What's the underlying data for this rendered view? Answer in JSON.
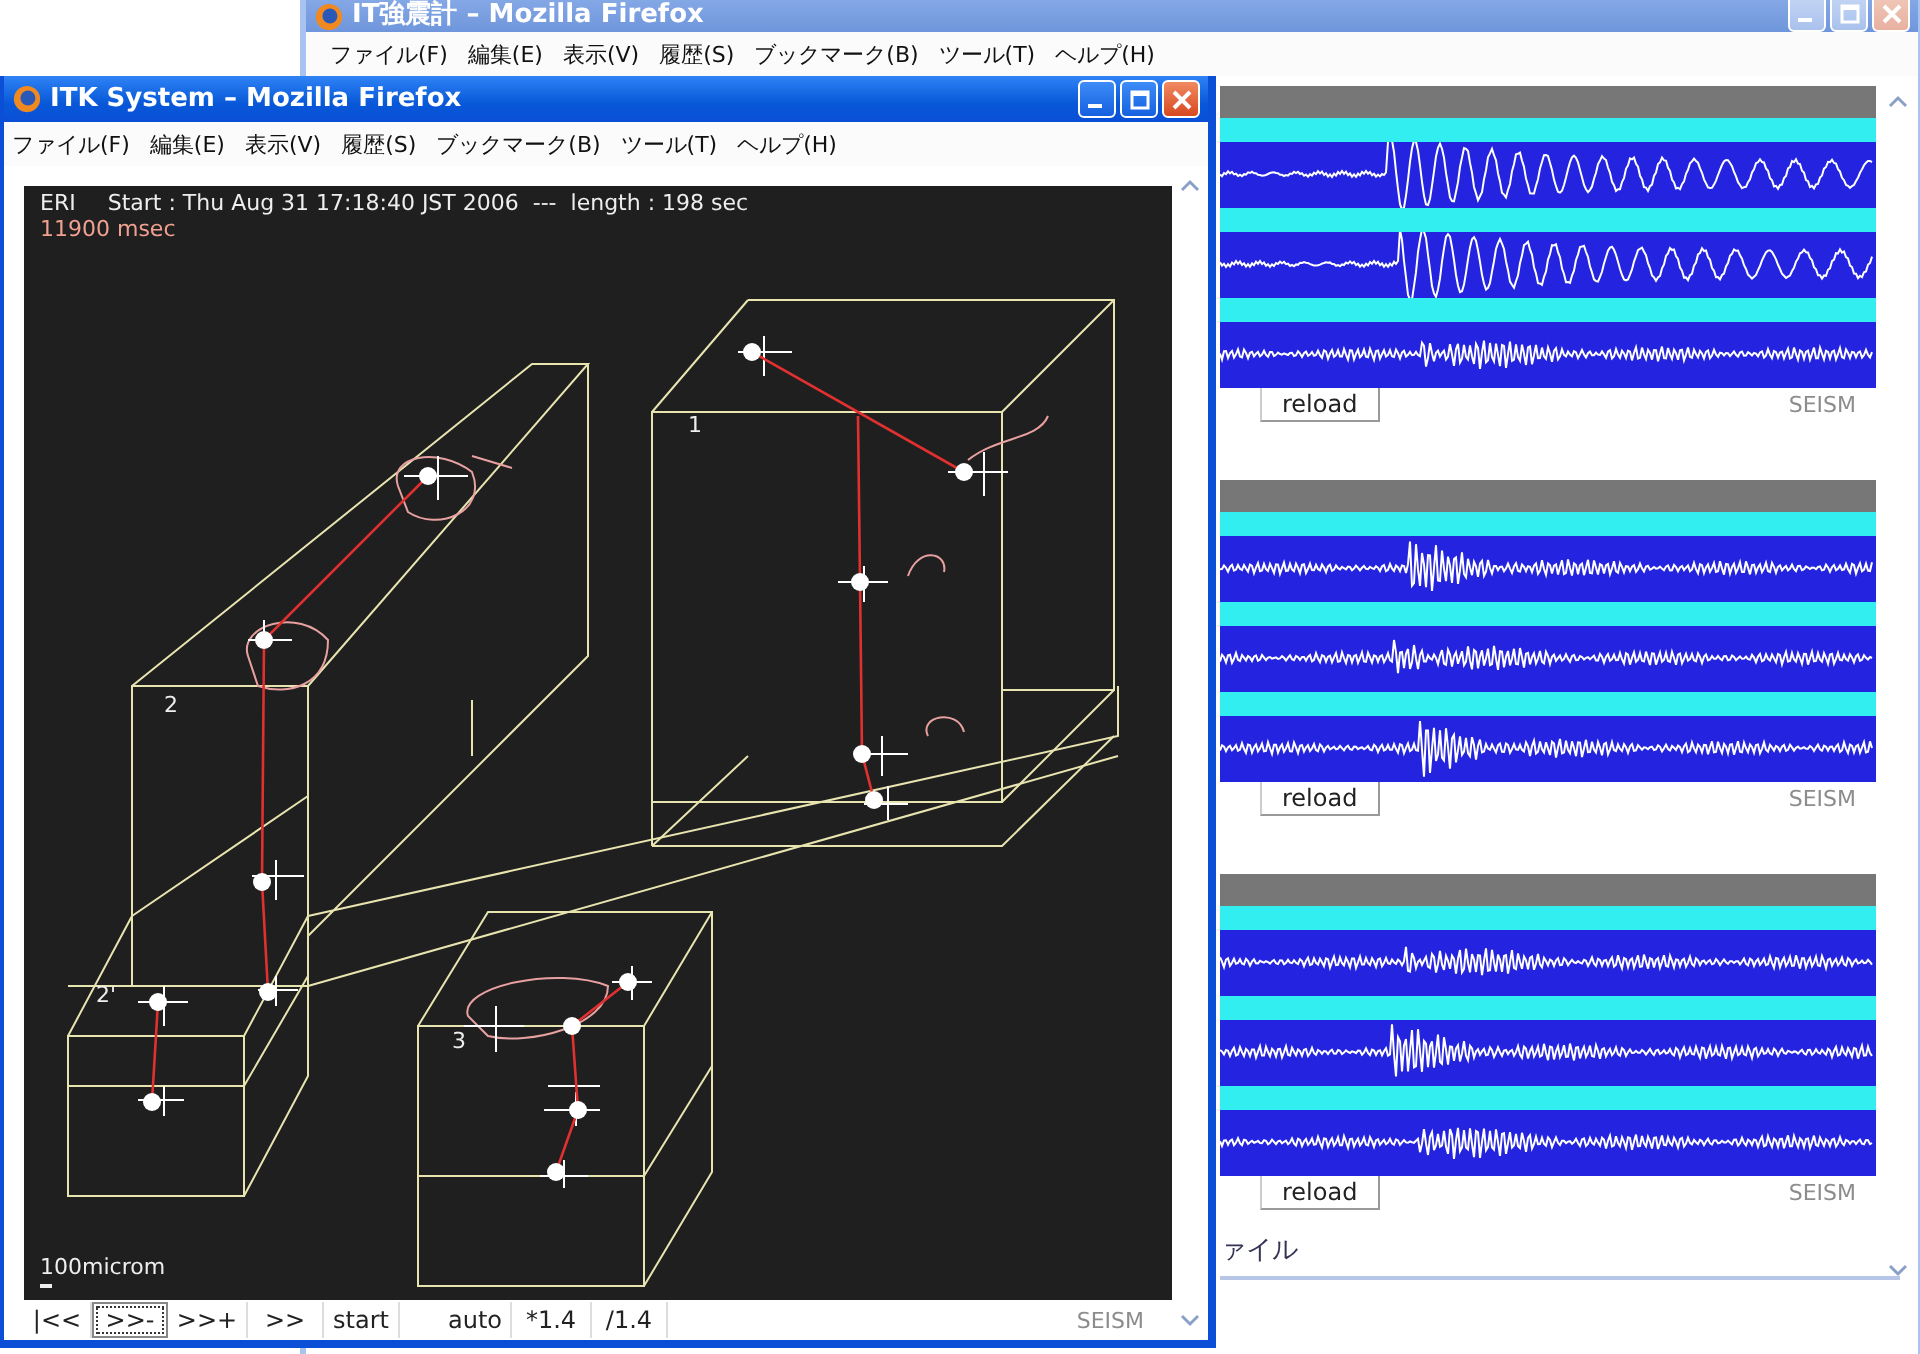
{
  "back_window": {
    "title": "IT強震計 – Mozilla Firefox",
    "menu": [
      "ファイル(F)",
      "編集(E)",
      "表示(V)",
      "履歴(S)",
      "ブックマーク(B)",
      "ツール(T)",
      "ヘルプ(H)"
    ],
    "stations": [
      {
        "button": "reload",
        "watermark": "SEISM"
      },
      {
        "button": "reload",
        "watermark": "SEISM"
      },
      {
        "button": "reload",
        "watermark": "SEISM"
      }
    ],
    "footer_text": "ァイル"
  },
  "front_window": {
    "title": "ITK System – Mozilla Firefox",
    "menu": [
      "ファイル(F)",
      "編集(E)",
      "表示(V)",
      "履歴(S)",
      "ブックマーク(B)",
      "ツール(T)",
      "ヘルプ(H)"
    ],
    "viewer": {
      "station": "ERI",
      "info": "Start : Thu Aug 31 17:18:40 JST 2006  ---  length : 198 sec",
      "time": "11900 msec",
      "labels": [
        "1",
        "2",
        "2'",
        "3"
      ],
      "scale": "100microm"
    },
    "controls": [
      {
        "label": "|<<",
        "focused": false
      },
      {
        "label": ">>-",
        "focused": true
      },
      {
        "label": ">>+",
        "focused": false
      },
      {
        "label": ">>",
        "focused": false
      },
      {
        "label": "start",
        "focused": false
      },
      {
        "label": "auto",
        "focused": false
      },
      {
        "label": "*1.4",
        "focused": false
      },
      {
        "label": "/1.4",
        "focused": false
      }
    ],
    "watermark": "SEISM"
  }
}
